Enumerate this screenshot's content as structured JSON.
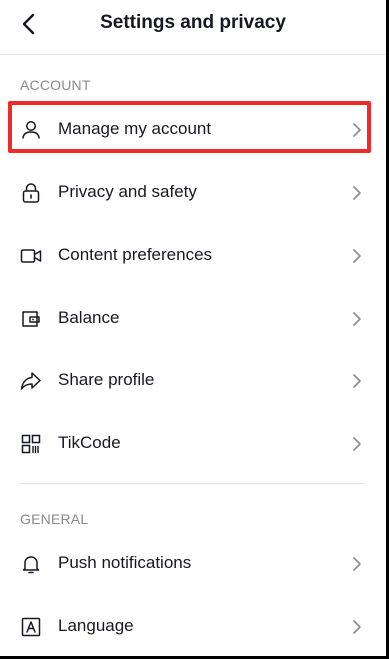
{
  "header": {
    "title": "Settings and privacy",
    "back_icon": "chevron-left-icon"
  },
  "sections": [
    {
      "label": "ACCOUNT",
      "items": [
        {
          "label": "Manage my account",
          "icon": "person-icon",
          "highlighted": true
        },
        {
          "label": "Privacy and safety",
          "icon": "lock-icon"
        },
        {
          "label": "Content preferences",
          "icon": "video-camera-icon"
        },
        {
          "label": "Balance",
          "icon": "wallet-icon"
        },
        {
          "label": "Share profile",
          "icon": "share-arrow-icon"
        },
        {
          "label": "TikCode",
          "icon": "qr-code-icon"
        }
      ]
    },
    {
      "label": "GENERAL",
      "items": [
        {
          "label": "Push notifications",
          "icon": "bell-icon"
        },
        {
          "label": "Language",
          "icon": "language-icon"
        }
      ]
    }
  ],
  "colors": {
    "highlight_border": "#ee2a2a",
    "text_primary": "#161823",
    "text_secondary": "#8a8b91",
    "divider": "#e3e3e4"
  }
}
